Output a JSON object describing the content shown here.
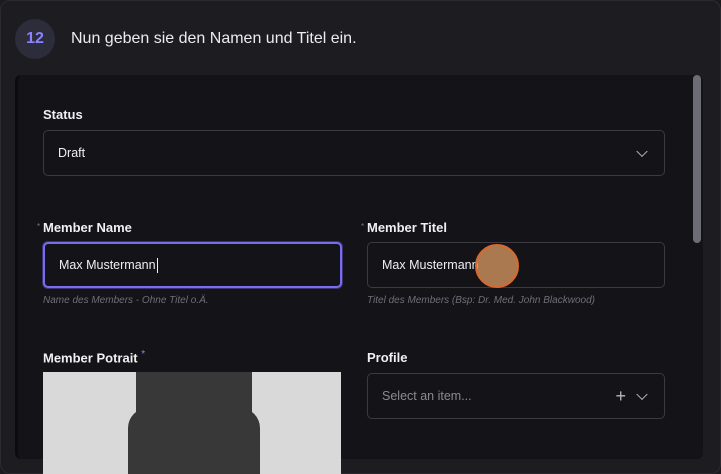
{
  "step": {
    "number": "12",
    "instruction": "Nun geben sie den Namen und Titel ein."
  },
  "form": {
    "status": {
      "label": "Status",
      "value": "Draft",
      "icon": "chevron-down-icon"
    },
    "member_name": {
      "label": "Member Name",
      "required_mark": "*",
      "value": "Max Mustermann",
      "hint": "Name des Members - Ohne Titel o.Ä."
    },
    "member_titel": {
      "label": "Member Titel",
      "required_mark": "*",
      "value": "Max Mustermann",
      "hint": "Titel des Members (Bsp: Dr. Med. John Blackwood)"
    },
    "member_portrait": {
      "label": "Member Potrait",
      "required_mark": "*"
    },
    "profile": {
      "label": "Profile",
      "placeholder": "Select an item...",
      "icons": [
        "plus-icon",
        "chevron-down-icon"
      ]
    }
  },
  "colors": {
    "accent": "#8b83ff",
    "focus_border": "#7a6cf0",
    "click_marker": "#d9692e"
  }
}
